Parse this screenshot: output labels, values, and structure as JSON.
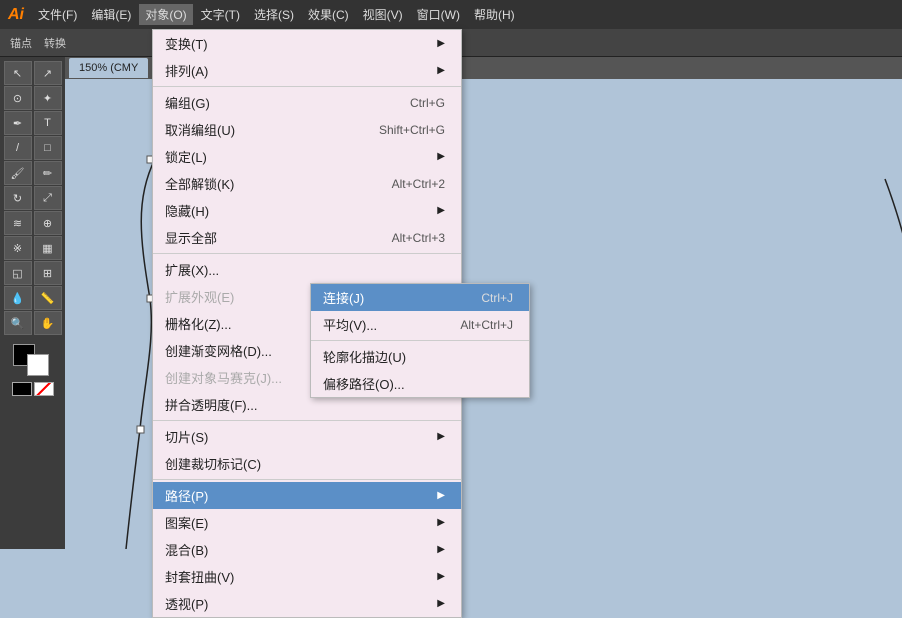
{
  "app": {
    "logo": "Ai",
    "title": "Adobe Illustrator"
  },
  "menubar": {
    "items": [
      {
        "label": "文件(F)",
        "active": false
      },
      {
        "label": "编辑(E)",
        "active": false
      },
      {
        "label": "对象(O)",
        "active": true
      },
      {
        "label": "文字(T)",
        "active": false
      },
      {
        "label": "选择(S)",
        "active": false
      },
      {
        "label": "效果(C)",
        "active": false
      },
      {
        "label": "视图(V)",
        "active": false
      },
      {
        "label": "窗口(W)",
        "active": false
      },
      {
        "label": "帮助(H)",
        "active": false
      }
    ]
  },
  "canvas_tab": "150% (CMY",
  "object_menu": {
    "items": [
      {
        "id": "transform",
        "label": "变换(T)",
        "shortcut": "",
        "has_arrow": true,
        "disabled": false
      },
      {
        "id": "arrange",
        "label": "排列(A)",
        "shortcut": "",
        "has_arrow": true,
        "disabled": false
      },
      {
        "id": "divider1",
        "type": "divider"
      },
      {
        "id": "group",
        "label": "编组(G)",
        "shortcut": "Ctrl+G",
        "disabled": false
      },
      {
        "id": "ungroup",
        "label": "取消编组(U)",
        "shortcut": "Shift+Ctrl+G",
        "disabled": false
      },
      {
        "id": "lock",
        "label": "锁定(L)",
        "shortcut": "",
        "has_arrow": true,
        "disabled": false
      },
      {
        "id": "unlock_all",
        "label": "全部解锁(K)",
        "shortcut": "Alt+Ctrl+2",
        "disabled": false
      },
      {
        "id": "hide",
        "label": "隐藏(H)",
        "shortcut": "",
        "has_arrow": true,
        "disabled": false
      },
      {
        "id": "show_all",
        "label": "显示全部",
        "shortcut": "Alt+Ctrl+3",
        "disabled": false
      },
      {
        "id": "divider2",
        "type": "divider"
      },
      {
        "id": "expand",
        "label": "扩展(X)...",
        "shortcut": "",
        "disabled": false
      },
      {
        "id": "expand_appearance",
        "label": "扩展外观(E)",
        "shortcut": "",
        "disabled": true
      },
      {
        "id": "rasterize",
        "label": "栅格化(Z)...",
        "shortcut": "",
        "disabled": false
      },
      {
        "id": "gradient_mesh",
        "label": "创建渐变网格(D)...",
        "shortcut": "",
        "disabled": false
      },
      {
        "id": "object_mosaic",
        "label": "创建对象马赛克(J)...",
        "shortcut": "",
        "disabled": true
      },
      {
        "id": "flatten_transparency",
        "label": "拼合透明度(F)...",
        "shortcut": "",
        "disabled": false
      },
      {
        "id": "divider3",
        "type": "divider"
      },
      {
        "id": "slice",
        "label": "切片(S)",
        "shortcut": "",
        "has_arrow": true,
        "disabled": false
      },
      {
        "id": "create_slice",
        "label": "创建裁切标记(C)",
        "shortcut": "",
        "disabled": false
      },
      {
        "id": "divider4",
        "type": "divider"
      },
      {
        "id": "path",
        "label": "路径(P)",
        "shortcut": "",
        "has_arrow": true,
        "disabled": false,
        "highlighted": true
      },
      {
        "id": "pattern",
        "label": "图案(E)",
        "shortcut": "",
        "has_arrow": true,
        "disabled": false
      },
      {
        "id": "blend",
        "label": "混合(B)",
        "shortcut": "",
        "has_arrow": true,
        "disabled": false
      },
      {
        "id": "envelope_distort",
        "label": "封套扭曲(V)",
        "shortcut": "",
        "has_arrow": true,
        "disabled": false
      },
      {
        "id": "perspective",
        "label": "透视(P)",
        "shortcut": "",
        "has_arrow": true,
        "disabled": false
      }
    ]
  },
  "path_submenu": {
    "items": [
      {
        "id": "join",
        "label": "连接(J)",
        "shortcut": "Ctrl+J",
        "highlighted": true
      },
      {
        "id": "average",
        "label": "平均(V)...",
        "shortcut": "Alt+Ctrl+J",
        "highlighted": false
      },
      {
        "id": "divider1",
        "type": "divider"
      },
      {
        "id": "outline_stroke",
        "label": "轮廓化描边(U)",
        "shortcut": "",
        "highlighted": false
      },
      {
        "id": "offset_path",
        "label": "偏移路径(O)...",
        "shortcut": "",
        "highlighted": false
      }
    ]
  },
  "colors": {
    "accent": "#5b8fc7",
    "menu_bg": "#f5e8f0",
    "highlighted_bg": "#5b8fc7"
  }
}
